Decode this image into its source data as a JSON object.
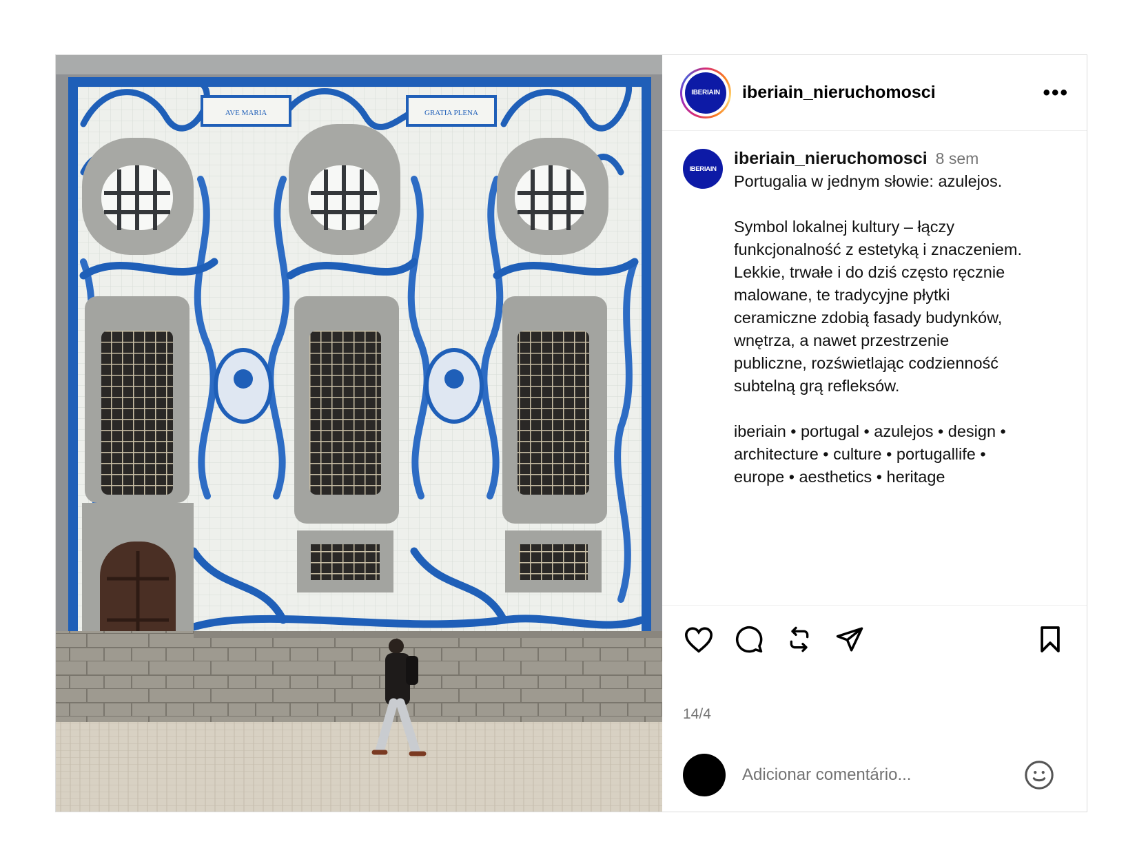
{
  "post": {
    "image_alt": "Blue azulejo tiled church facade in Porto with a man walking past",
    "image_text": {
      "cartouche_left": "AVE MARIA",
      "cartouche_right": "GRATIA PLENA"
    }
  },
  "header": {
    "avatar_text": "IBERIAIN",
    "username": "iberiain_nieruchomosci",
    "more_label": "•••"
  },
  "caption": {
    "avatar_text": "IBERIAIN",
    "username": "iberiain_nieruchomosci",
    "time": "8 sem",
    "line1": "Portugalia w jednym słowie: azulejos.",
    "paragraph2": "Symbol lokalnej kultury – łączy\nfunkcjonalność z estetyką i znaczeniem.\nLekkie, trwałe i do dziś często ręcznie\nmalowane, te tradycyjne płytki\nceramiczne zdobią fasady budynków,\nwnętrza, a nawet przestrzenie\npubliczne, rozświetlając codzienność\nsubtelną grą refleksów.",
    "tags": "iberiain • portugal • azulejos • design •\narchitecture • culture • portugallife •\neurope • aesthetics • heritage"
  },
  "actions": {
    "like": "heart-icon",
    "comment": "comment-icon",
    "repost": "repost-icon",
    "share": "send-icon",
    "save": "bookmark-icon"
  },
  "date": "14/4",
  "comment_box": {
    "placeholder": "Adicionar comentário..."
  },
  "colors": {
    "azulejo_blue": "#1f5fb8",
    "brand_blue": "#0d1aa6",
    "muted_text": "#737373"
  }
}
